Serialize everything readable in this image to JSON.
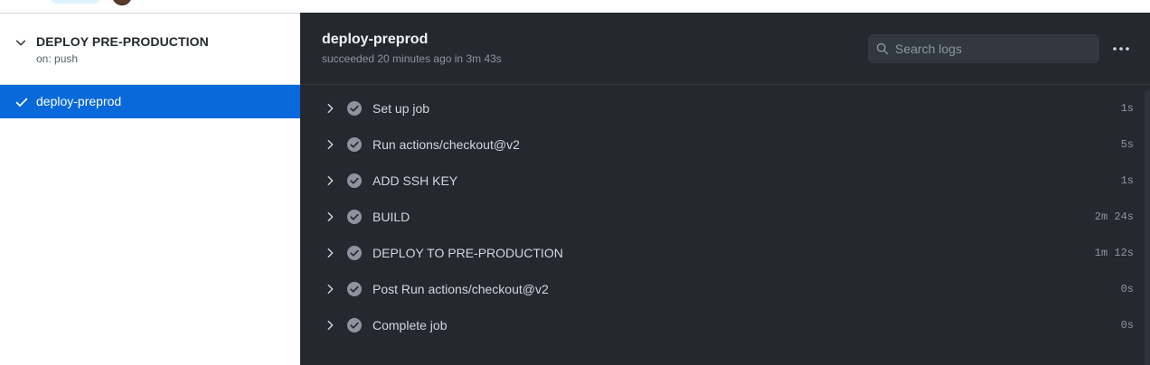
{
  "workflow": {
    "title": "DEPLOY PRE-PRODUCTION",
    "trigger": "on: push"
  },
  "sidebar": {
    "jobs": [
      {
        "label": "deploy-preprod",
        "status": "success",
        "selected": true
      }
    ]
  },
  "job": {
    "title": "deploy-preprod",
    "status_text": "succeeded 20 minutes ago in 3m 43s"
  },
  "search": {
    "placeholder": "Search logs",
    "value": ""
  },
  "steps": [
    {
      "name": "Set up job",
      "duration": "1s",
      "status": "success"
    },
    {
      "name": "Run actions/checkout@v2",
      "duration": "5s",
      "status": "success"
    },
    {
      "name": "ADD SSH KEY",
      "duration": "1s",
      "status": "success"
    },
    {
      "name": "BUILD",
      "duration": "2m 24s",
      "status": "success"
    },
    {
      "name": "DEPLOY TO PRE-PRODUCTION",
      "duration": "1m 12s",
      "status": "success"
    },
    {
      "name": "Post Run actions/checkout@v2",
      "duration": "0s",
      "status": "success"
    },
    {
      "name": "Complete job",
      "duration": "0s",
      "status": "success"
    }
  ],
  "icons": {
    "collapse": "chevron-down-icon",
    "selected_job": "check-icon",
    "search": "search-icon",
    "more": "kebab-horizontal-icon",
    "step_expand": "chevron-right-icon",
    "step_status": "check-circle-fill-icon"
  },
  "colors": {
    "accent": "#0969da",
    "panel_bg": "#24292f",
    "success_icon": "#8c959f"
  }
}
